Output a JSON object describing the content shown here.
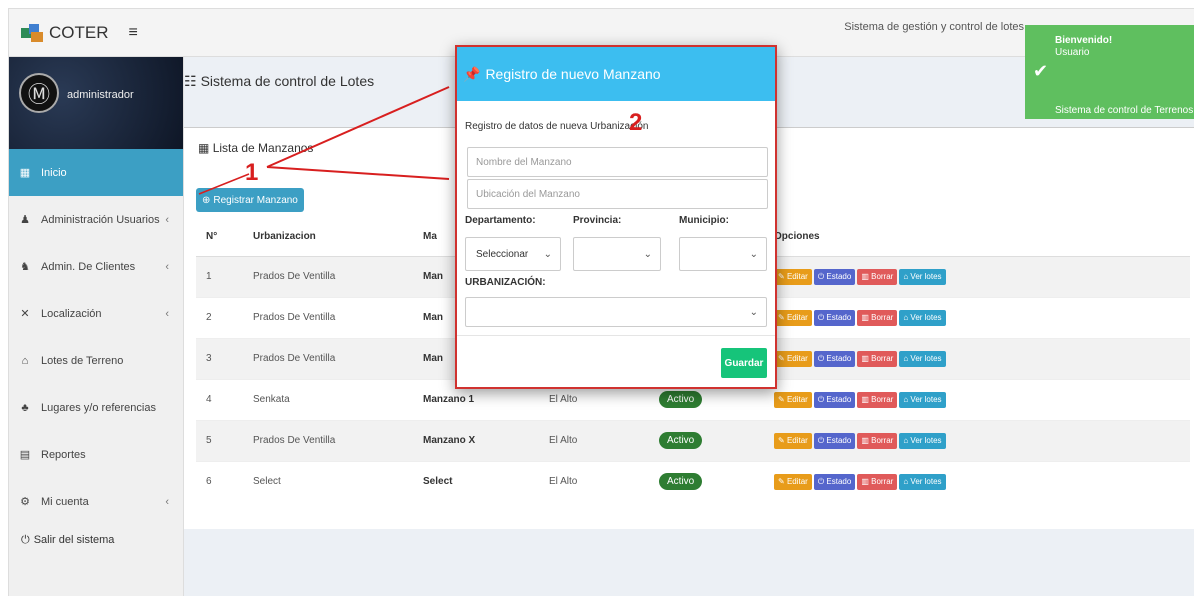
{
  "app": {
    "name": "COTER",
    "menu_icon": "hamburger-icon",
    "system_title": "Sistema de gestión y control de lotes",
    "user_top": "administrador"
  },
  "sidebar": {
    "username": "administrador",
    "items": [
      {
        "label": "Inicio",
        "icon": "dashboard-icon",
        "active": true,
        "has_submenu": false
      },
      {
        "label": "Administración Usuarios",
        "icon": "user-icon",
        "has_submenu": true
      },
      {
        "label": "Admin. De Clientes",
        "icon": "users-icon",
        "has_submenu": true
      },
      {
        "label": "Localización",
        "icon": "map-icon",
        "has_submenu": true
      },
      {
        "label": "Lotes de Terreno",
        "icon": "home-icon",
        "has_submenu": false
      },
      {
        "label": "Lugares y/o referencias",
        "icon": "tree-icon",
        "has_submenu": false
      },
      {
        "label": "Reportes",
        "icon": "file-icon",
        "has_submenu": false
      },
      {
        "label": "Mi cuenta",
        "icon": "cogs-icon",
        "has_submenu": true
      }
    ],
    "logout": "Salir del sistema"
  },
  "content": {
    "header": "Sistema de control de Lotes",
    "box_title": "Lista de Manzanos",
    "register_button": "Registrar Manzano",
    "table": {
      "columns": [
        "N°",
        "Urbanizacion",
        "Ma",
        "",
        "",
        "Opciones"
      ],
      "rows": [
        {
          "n": "1",
          "urb": "Prados De Ventilla",
          "manzano": "Man",
          "loc": "",
          "estado": ""
        },
        {
          "n": "2",
          "urb": "Prados De Ventilla",
          "manzano": "Man",
          "loc": "",
          "estado": ""
        },
        {
          "n": "3",
          "urb": "Prados De Ventilla",
          "manzano": "Man",
          "loc": "",
          "estado": ""
        },
        {
          "n": "4",
          "urb": "Senkata",
          "manzano": "Manzano 1",
          "loc": "El Alto",
          "estado": "Activo"
        },
        {
          "n": "5",
          "urb": "Prados De Ventilla",
          "manzano": "Manzano X",
          "loc": "El Alto",
          "estado": "Activo"
        },
        {
          "n": "6",
          "urb": "Select",
          "manzano": "Select",
          "loc": "El Alto",
          "estado": "Activo"
        }
      ],
      "actions": {
        "editar": "Editar",
        "estado": "Estado",
        "borrar": "Borrar",
        "ver_lotes": "Ver lotes"
      }
    }
  },
  "modal": {
    "title": "Registro de nuevo Manzano",
    "subtitle": "Registro de datos de nueva Urbanización",
    "name_placeholder": "Nombre del Manzano",
    "location_placeholder": "Ubicación del Manzano",
    "departamento_label": "Departamento:",
    "departamento_value": "Seleccionar",
    "provincia_label": "Provincia:",
    "provincia_value": "",
    "municipio_label": "Municipio:",
    "municipio_value": "",
    "urbanizacion_label": "URBANIZACIÓN:",
    "urbanizacion_value": "",
    "save_button": "Guardar"
  },
  "annotations": {
    "one": "1",
    "two": "2"
  },
  "toast": {
    "title": "Bienvenido!",
    "line1": "Usuario",
    "line2": "Sistema de control de Terrenos!"
  },
  "colors": {
    "accent": "#3c9fc4",
    "modal_header": "#3cbef0",
    "save": "#16c47a",
    "annotation": "#d81f1f",
    "toast": "#5fbf5f"
  }
}
